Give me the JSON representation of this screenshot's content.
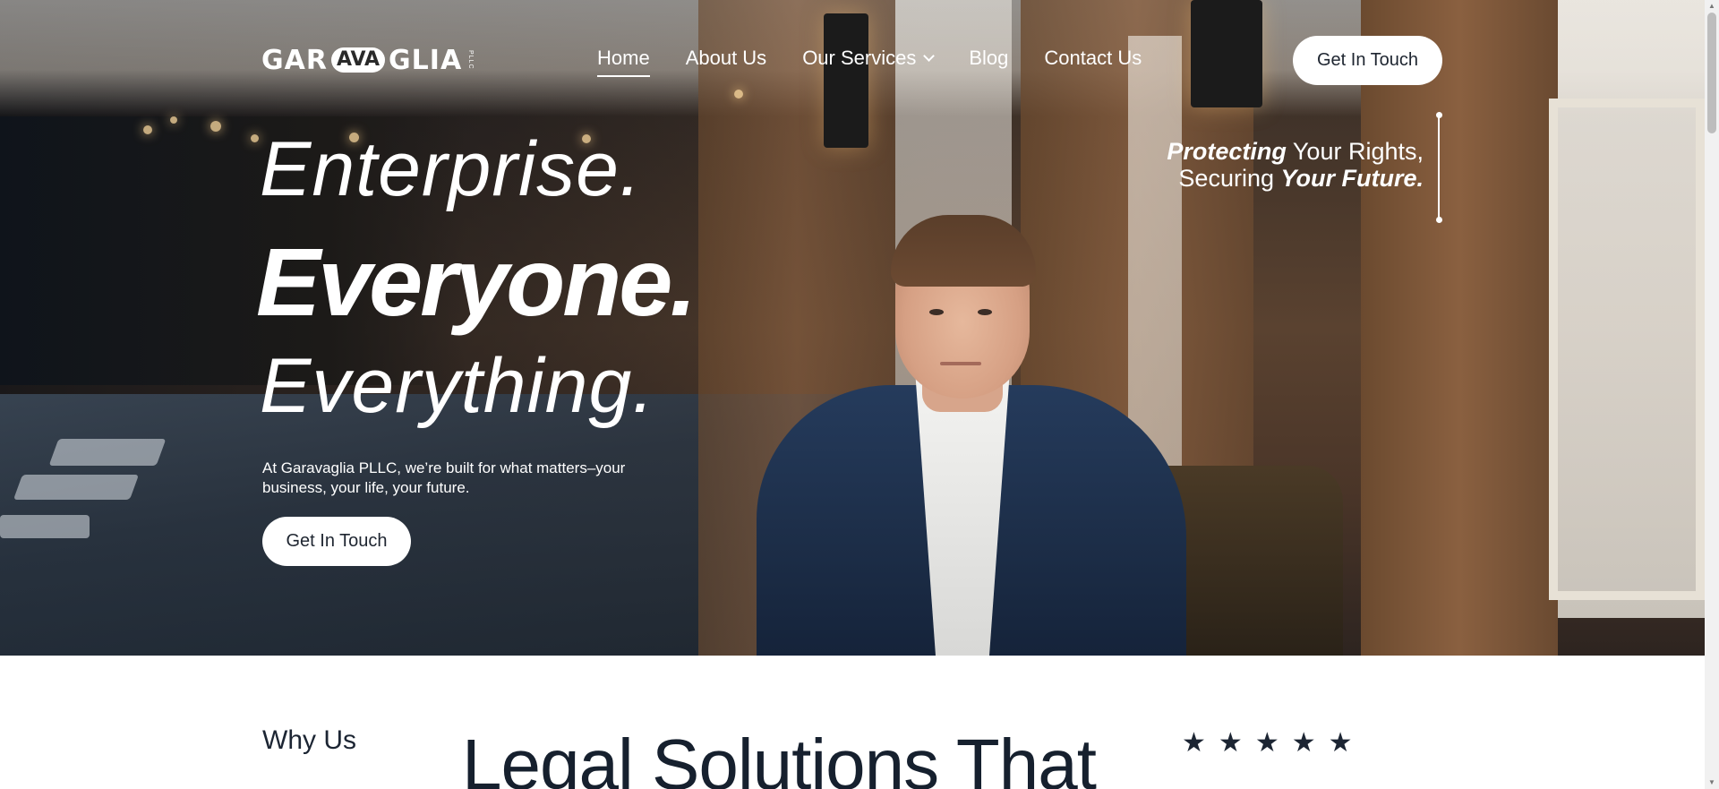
{
  "header": {
    "logo_left": "GAR",
    "logo_box": "AVA",
    "logo_right": "GLIA",
    "logo_sub": "PLLC",
    "nav": [
      {
        "label": "Home",
        "active": true
      },
      {
        "label": "About Us",
        "active": false
      },
      {
        "label": "Our Services",
        "active": false,
        "dropdown": true
      },
      {
        "label": "Blog",
        "active": false
      },
      {
        "label": "Contact Us",
        "active": false
      }
    ],
    "cta_label": "Get In Touch"
  },
  "hero": {
    "line1": "Enterprise.",
    "line2": "Everyone.",
    "line3": "Everything.",
    "subtitle": "At Garavaglia PLLC, we’re built for what matters–your business, your life, your future.",
    "cta_label": "Get In Touch",
    "tagline": {
      "part1_bold": "Protecting",
      "part1_rest": " Your Rights,",
      "part2_rest": "Securing ",
      "part2_bold": "Your Future."
    }
  },
  "section": {
    "why_label": "Why Us",
    "title": "Legal Solutions That",
    "stars": [
      "★",
      "★",
      "★",
      "★",
      "★"
    ]
  },
  "colors": {
    "text_dark": "#16202e",
    "white": "#ffffff",
    "jacket_navy": "#1c2d47"
  }
}
